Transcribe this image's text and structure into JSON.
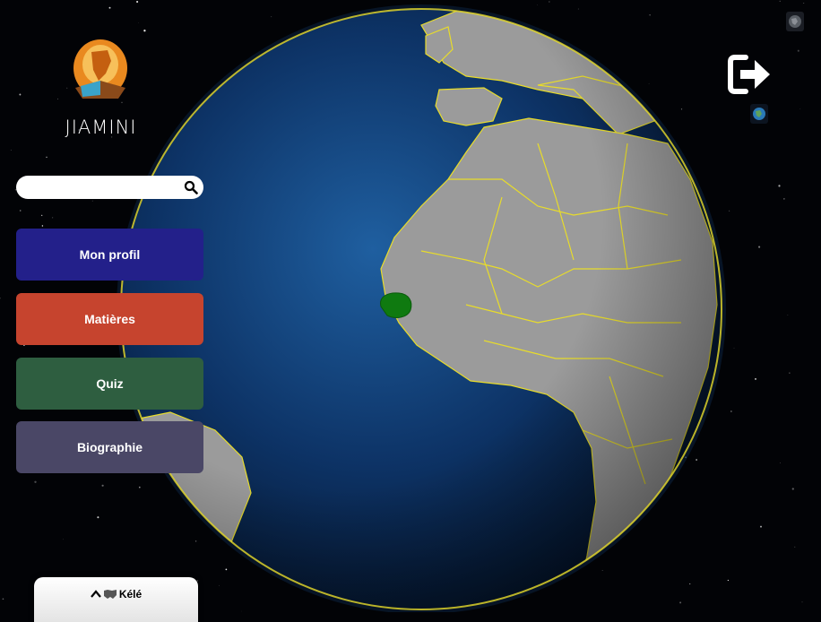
{
  "app": {
    "title": "JIAMINI"
  },
  "search": {
    "placeholder": "",
    "value": ""
  },
  "menu": [
    {
      "label": "Mon profil",
      "color": "#23208a"
    },
    {
      "label": "Matières",
      "color": "#c6442e"
    },
    {
      "label": "Quiz",
      "color": "#2e5e40"
    },
    {
      "label": "Biographie",
      "color": "#4a4766"
    }
  ],
  "bottom_panel": {
    "tab_label": "Kélé",
    "icons": [
      "chevron-up-icon",
      "map-icon"
    ]
  },
  "globe": {
    "ocean_color": "#0f3a6e",
    "land_color": "#9b9b9b",
    "border_color": "#e8dc2a",
    "highlight_color": "#0f7a10",
    "highlighted_country": "Senegal"
  },
  "icons": [
    "app-logo",
    "search-icon",
    "logout-icon",
    "globe-view-icon"
  ]
}
